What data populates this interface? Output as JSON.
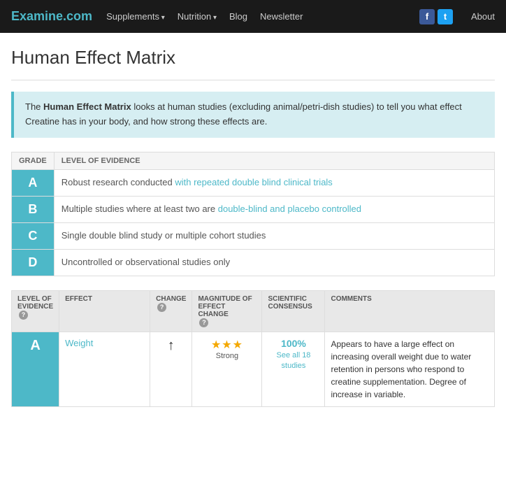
{
  "nav": {
    "logo": "Examine.com",
    "links": [
      {
        "label": "Supplements",
        "dropdown": true
      },
      {
        "label": "Nutrition",
        "dropdown": true
      },
      {
        "label": "Blog",
        "dropdown": false
      },
      {
        "label": "Newsletter",
        "dropdown": false
      }
    ],
    "social": [
      {
        "label": "f",
        "type": "facebook"
      },
      {
        "label": "t",
        "type": "twitter"
      }
    ],
    "about_label": "About"
  },
  "page": {
    "title": "Human Effect Matrix",
    "divider": true,
    "info_box": {
      "prefix": "The ",
      "bold": "Human Effect Matrix",
      "suffix": " looks at human studies (excluding animal/petri-dish studies) to tell you what effect Creatine has in your body, and how strong these effects are."
    },
    "grade_table": {
      "col_grade": "GRADE",
      "col_evidence": "LEVEL OF EVIDENCE",
      "rows": [
        {
          "grade": "A",
          "description": "Robust research conducted with repeated double blind clinical trials",
          "highlight_words": "with repeated double blind clinical trials"
        },
        {
          "grade": "B",
          "description": "Multiple studies where at least two are double-blind and placebo controlled",
          "highlight_words": "double-blind and placebo controlled"
        },
        {
          "grade": "C",
          "description": "Single double blind study or multiple cohort studies",
          "highlight_words": ""
        },
        {
          "grade": "D",
          "description": "Uncontrolled or observational studies only",
          "highlight_words": ""
        }
      ]
    },
    "matrix_table": {
      "headers": {
        "level_of_evidence": "LEVEL OF EVIDENCE",
        "level_q": "?",
        "effect": "EFFECT",
        "change": "CHANGE",
        "change_q": "?",
        "magnitude": "MAGNITUDE OF EFFECT CHANGE",
        "magnitude_q": "?",
        "consensus": "SCIENTIFIC CONSENSUS",
        "comments": "COMMENTS"
      },
      "rows": [
        {
          "grade": "A",
          "effect": "Weight",
          "change_arrow": "↑",
          "stars": "★★★",
          "stars_label": "Strong",
          "consensus_pct": "100%",
          "consensus_link": "See all 18 studies",
          "comments": "Appears to have a large effect on increasing overall weight due to water retention in persons who respond to creatine supplementation. Degree of increase in variable."
        }
      ]
    }
  }
}
